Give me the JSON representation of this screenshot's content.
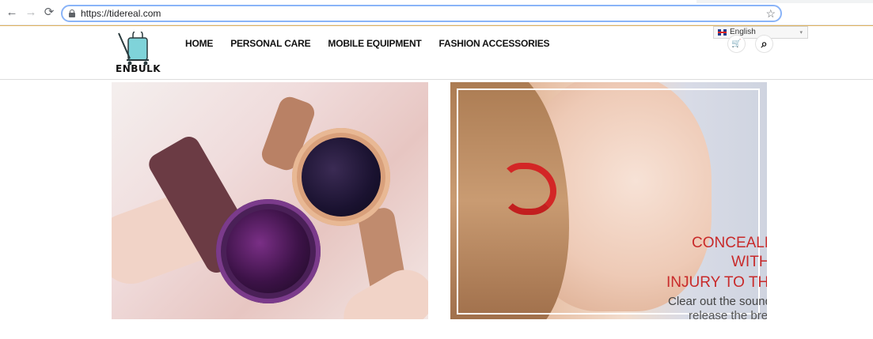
{
  "browser": {
    "url": "https://tidereal.com",
    "back_icon": "←",
    "forward_icon": "→",
    "reload_icon": "⟳",
    "star_icon": "☆"
  },
  "site": {
    "logo_text": "ENBULK",
    "accent_color": "#e0b35e",
    "menu": [
      {
        "label": "HOME"
      },
      {
        "label": "PERSONAL CARE"
      },
      {
        "label": "MOBILE EQUIPMENT"
      },
      {
        "label": "FASHION ACCESSORIES"
      }
    ],
    "language": {
      "selected": "English",
      "caret": "▾"
    },
    "cart_icon": "🛒",
    "search_icon": "⌕"
  },
  "banners": {
    "right": {
      "line1": "CONCEALM",
      "line2": "WITHO",
      "line3": "INJURY TO THE",
      "line4": "Clear out the sound",
      "line5": "release the bre",
      "text_color": "#c82a2a"
    }
  }
}
